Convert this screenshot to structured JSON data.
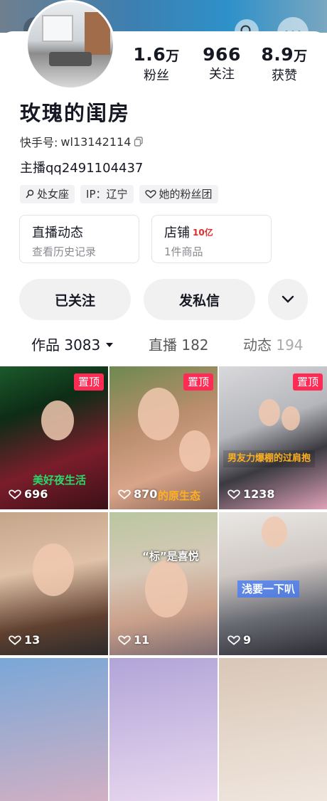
{
  "profile": {
    "stats": {
      "fans": {
        "value": "1.6",
        "unit": "万",
        "label": "粉丝"
      },
      "following": {
        "value": "966",
        "unit": "",
        "label": "关注"
      },
      "likes": {
        "value": "8.9",
        "unit": "万",
        "label": "获赞"
      }
    },
    "name": "玫瑰的闺房",
    "kuaishou_id_label": "快手号:",
    "kuaishou_id": "wl13142114",
    "anchor_text": "主播qq2491104437",
    "tags": [
      {
        "icon": "female-icon",
        "label": "处女座"
      },
      {
        "icon": "",
        "label": "IP：辽宁"
      },
      {
        "icon": "heart-icon",
        "label": "她的粉丝团"
      }
    ]
  },
  "cards": {
    "live": {
      "title": "直播动态",
      "subtitle": "查看历史记录"
    },
    "shop": {
      "title": "店铺",
      "badge": "10亿",
      "subtitle": "1件商品"
    }
  },
  "actions": {
    "follow": "已关注",
    "message": "发私信"
  },
  "tabs": [
    {
      "label": "作品",
      "count": "3083"
    },
    {
      "label": "直播",
      "count": "182"
    },
    {
      "label": "动态",
      "count": "194"
    }
  ],
  "grid": {
    "pinned_label": "置顶",
    "items": [
      {
        "likes": "696",
        "pinned": true,
        "caption": "美好夜生活"
      },
      {
        "likes": "870",
        "pinned": true,
        "caption": "的原生态"
      },
      {
        "likes": "1238",
        "pinned": true,
        "caption": "男友力爆棚的过肩抱"
      },
      {
        "likes": "13",
        "pinned": false,
        "caption": ""
      },
      {
        "likes": "11",
        "pinned": false,
        "caption": "“标”是喜悦"
      },
      {
        "likes": "9",
        "pinned": false,
        "caption": "浅要一下叭"
      }
    ]
  },
  "colors": {
    "accent": "#fe2c55",
    "caption_green": "#2bd96a",
    "caption_orange": "#ffb020"
  }
}
